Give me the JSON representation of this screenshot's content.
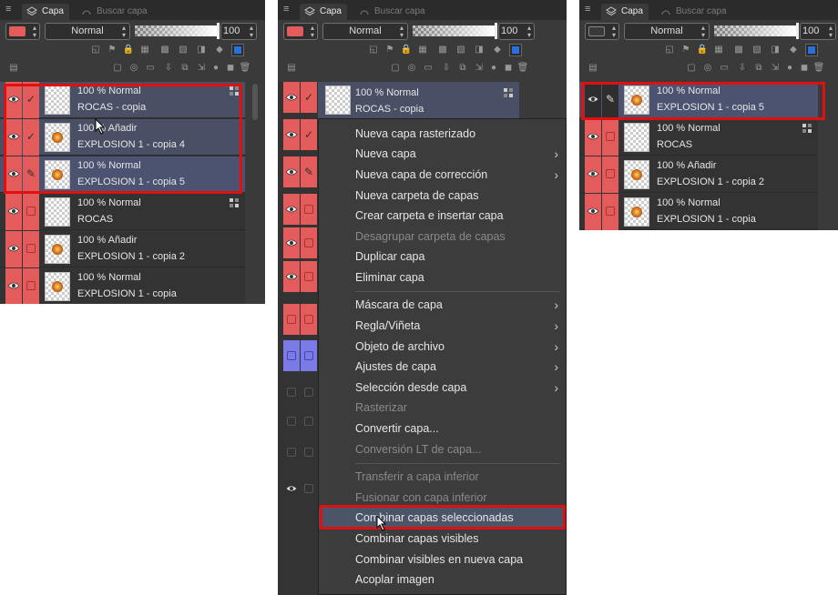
{
  "tabs": {
    "active": "Capa",
    "inactive": "Buscar capa"
  },
  "colors": {
    "visibility_red": "#e35b5b",
    "selected_row": "#495065",
    "highlight_border": "#e01010",
    "menu_hover": "#4c5468",
    "blue_row": "#7b7be8"
  },
  "panel1": {
    "blend_mode": "Normal",
    "opacity_value": "100",
    "swatch_color": "#e35b5b",
    "layers": [
      {
        "line1": "100 % Normal",
        "line2": "ROCAS - copia",
        "state": "selected",
        "mark": "check",
        "thumb": "empty"
      },
      {
        "line1": "100 % Añadir",
        "line2": "EXPLOSION 1 - copia 4",
        "state": "selected",
        "mark": "check",
        "thumb": "explosion"
      },
      {
        "line1": "100 % Normal",
        "line2": "EXPLOSION 1 - copia 5",
        "state": "active",
        "mark": "pen",
        "thumb": "explosion"
      },
      {
        "line1": "100 % Normal",
        "line2": "ROCAS",
        "state": "normal",
        "mark": "box",
        "thumb": "empty"
      },
      {
        "line1": "100 % Añadir",
        "line2": "EXPLOSION 1 - copia 2",
        "state": "normal",
        "mark": "box",
        "thumb": "explosion"
      },
      {
        "line1": "100 % Normal",
        "line2": "EXPLOSION 1 - copia",
        "state": "normal",
        "mark": "box",
        "thumb": "explosion"
      }
    ]
  },
  "panel2": {
    "blend_mode": "Normal",
    "opacity_value": "100",
    "swatch_color": "#e35b5b",
    "top_layer": {
      "line1": "100 % Normal",
      "line2": "ROCAS - copia"
    },
    "menu": [
      {
        "label": "Nueva capa rasterizado",
        "disabled": false,
        "submenu": false
      },
      {
        "label": "Nueva capa",
        "disabled": false,
        "submenu": true
      },
      {
        "label": "Nueva capa de corrección",
        "disabled": false,
        "submenu": true
      },
      {
        "label": "Nueva carpeta de capas",
        "disabled": false,
        "submenu": false
      },
      {
        "label": "Crear carpeta e insertar capa",
        "disabled": false,
        "submenu": false
      },
      {
        "label": "Desagrupar carpeta de capas",
        "disabled": true,
        "submenu": false
      },
      {
        "label": "Duplicar capa",
        "disabled": false,
        "submenu": false
      },
      {
        "label": "Eliminar capa",
        "disabled": false,
        "submenu": false
      },
      {
        "label": "Máscara de capa",
        "disabled": false,
        "submenu": true
      },
      {
        "label": "Regla/Viñeta",
        "disabled": false,
        "submenu": true
      },
      {
        "label": "Objeto de archivo",
        "disabled": false,
        "submenu": true
      },
      {
        "label": "Ajustes de capa",
        "disabled": false,
        "submenu": true
      },
      {
        "label": "Selección desde capa",
        "disabled": false,
        "submenu": true
      },
      {
        "label": "Rasterizar",
        "disabled": true,
        "submenu": false
      },
      {
        "label": "Convertir capa...",
        "disabled": false,
        "submenu": false
      },
      {
        "label": "Conversión LT de capa...",
        "disabled": true,
        "submenu": false
      },
      {
        "label": "Transferir a capa inferior",
        "disabled": true,
        "submenu": false
      },
      {
        "label": "Fusionar con capa inferior",
        "disabled": true,
        "submenu": false
      },
      {
        "label": "Combinar capas seleccionadas",
        "disabled": false,
        "submenu": false,
        "hover": true
      },
      {
        "label": "Combinar capas visibles",
        "disabled": false,
        "submenu": false
      },
      {
        "label": "Combinar visibles en nueva capa",
        "disabled": false,
        "submenu": false
      },
      {
        "label": "Acoplar imagen",
        "disabled": false,
        "submenu": false
      }
    ]
  },
  "panel3": {
    "blend_mode": "Normal",
    "opacity_value": "100",
    "swatch_color": "#3a3a3a",
    "layers": [
      {
        "line1": "100 % Normal",
        "line2": "EXPLOSION 1 - copia 5",
        "state": "active",
        "mark": "pen",
        "thumb": "explosion"
      },
      {
        "line1": "100 % Normal",
        "line2": "ROCAS",
        "state": "normal",
        "mark": "box",
        "thumb": "empty"
      },
      {
        "line1": "100 % Añadir",
        "line2": "EXPLOSION 1 - copia 2",
        "state": "normal",
        "mark": "box",
        "thumb": "explosion"
      },
      {
        "line1": "100 % Normal",
        "line2": "EXPLOSION 1 - copia",
        "state": "normal",
        "mark": "box",
        "thumb": "explosion"
      }
    ]
  }
}
